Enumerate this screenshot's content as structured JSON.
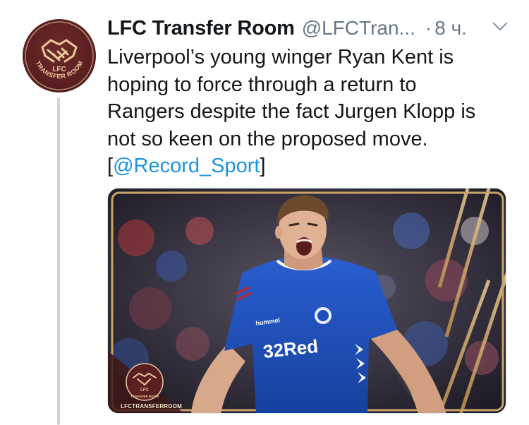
{
  "avatar": {
    "text_top": "LFC",
    "text_bottom": "TRANSFER ROOM",
    "colors": {
      "bg": "#5a1f20",
      "accent": "#e8c99a"
    }
  },
  "tweet": {
    "display_name": "LFC Transfer Room",
    "handle": "@LFCTran...",
    "separator": "·",
    "time": "8 ч.",
    "text_lines": [
      "Liverpool’s young winger Ryan Kent is",
      "hoping to force through a return to",
      "Rangers despite the fact Jurgen Klopp is",
      "not so keen on the proposed move."
    ],
    "text_open_bracket": "[",
    "mention": "@Record_Sport",
    "text_close_bracket": "]"
  },
  "media": {
    "jersey_sponsor": "32Red",
    "jersey_brand": "hummel",
    "watermark_logo_top": "LFC",
    "watermark_logo_bottom": "TRANSFER ROOM",
    "watermark_text": "LFCTRANSFERROOM",
    "colors": {
      "jersey": "#1e4fb8",
      "frame": "#c9a46a",
      "logo": "#5a1f20"
    }
  },
  "icons": [
    "avatar-logo-icon",
    "more-options-chevron-icon",
    "handshake-icon"
  ],
  "colors": {
    "text": "#14171a",
    "muted": "#657786",
    "link": "#1b95e0",
    "thread": "#ccd6dd"
  }
}
